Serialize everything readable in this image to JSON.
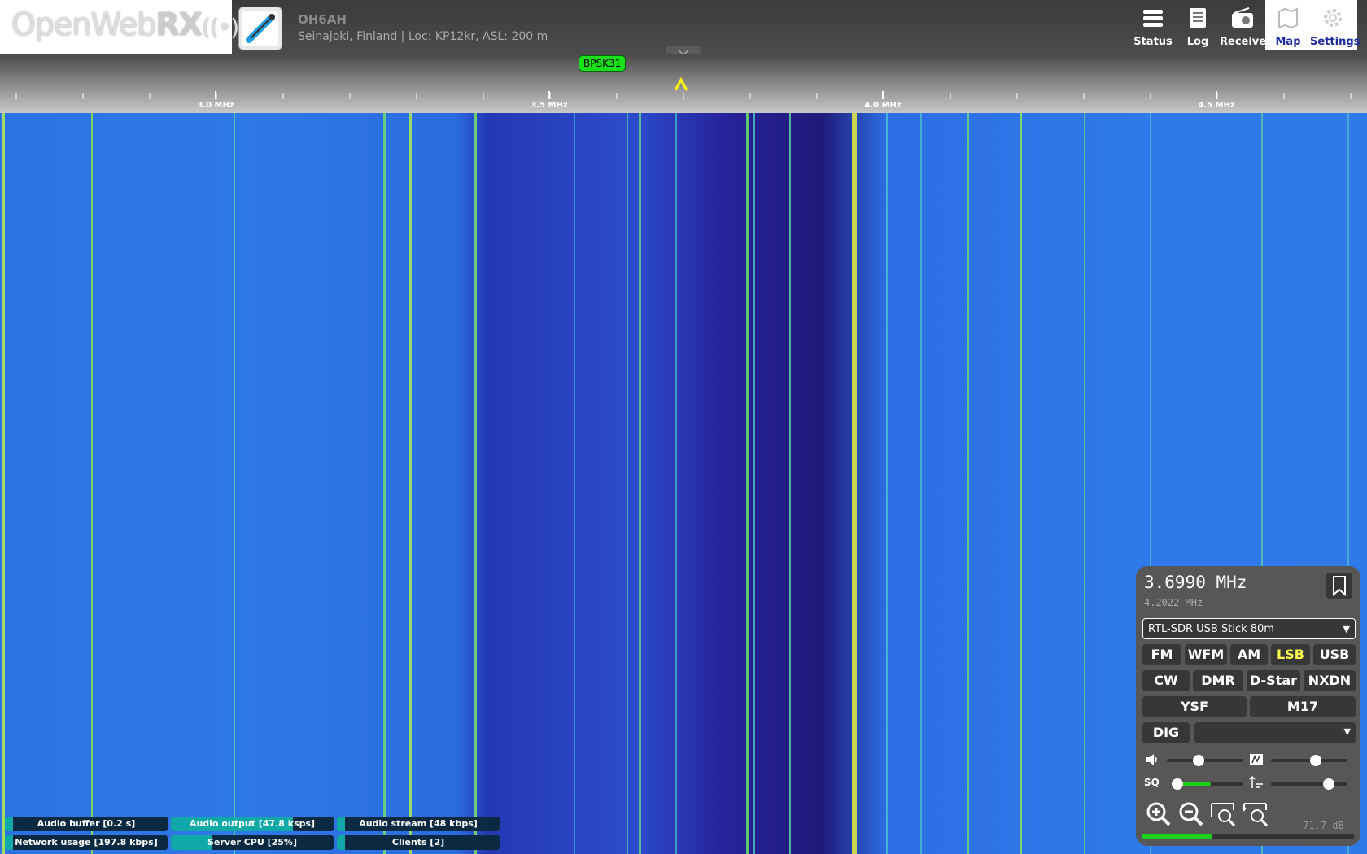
{
  "header": {
    "logo": {
      "open": "Open",
      "web": "Web",
      "rx": "RX"
    },
    "receiver_name": "OH6AH",
    "receiver_desc": "Seinajoki, Finland | Loc: KP12kr, ASL: 200 m",
    "buttons": [
      {
        "label": "Status",
        "icon": "status-icon"
      },
      {
        "label": "Log",
        "icon": "log-icon"
      },
      {
        "label": "Receiver",
        "icon": "radio-icon"
      },
      {
        "label": "Map",
        "icon": "map-icon"
      },
      {
        "label": "Settings",
        "icon": "gear-icon"
      }
    ]
  },
  "scale": {
    "labels": [
      "3.0 MHz",
      "3.5 MHz",
      "4.0 MHz",
      "4.5 MHz"
    ],
    "bookmark": "BPSK31",
    "tuning_marker_color": "#ffff00"
  },
  "status": [
    {
      "label": "Audio buffer [0.2 s]",
      "level": 0.05
    },
    {
      "label": "Audio output [47.8 ksps]",
      "level": 0.72
    },
    {
      "label": "Audio stream [48 kbps]",
      "level": 0.05
    },
    {
      "label": "Network usage [197.8 kbps]",
      "level": 0.05
    },
    {
      "label": "Server CPU [25%]",
      "level": 0.25
    },
    {
      "label": "Clients [2]",
      "level": 0.05
    }
  ],
  "panel": {
    "frequency": "3.6990 MHz",
    "offset_frequency": "4.2022 MHz",
    "profile": "RTL-SDR USB Stick 80m",
    "modes_row1": [
      "FM",
      "WFM",
      "AM",
      "LSB",
      "USB"
    ],
    "modes_row2": [
      "CW",
      "DMR",
      "D-Star",
      "NXDN"
    ],
    "modes_row3": [
      "YSF",
      "M17"
    ],
    "dig_label": "DIG",
    "selected_mode": "LSB",
    "squelch_label": "SQ",
    "volume_level": 0.4,
    "squelch_level": 0.0,
    "nr_level": 0.6,
    "gain_level": 0.8,
    "smeter_text": "-71.7 dB",
    "smeter_level": 0.33,
    "zoom_buttons": [
      "zoom-in-icon",
      "zoom-out-icon",
      "zoom-to-band-icon",
      "zoom-reset-icon"
    ]
  }
}
